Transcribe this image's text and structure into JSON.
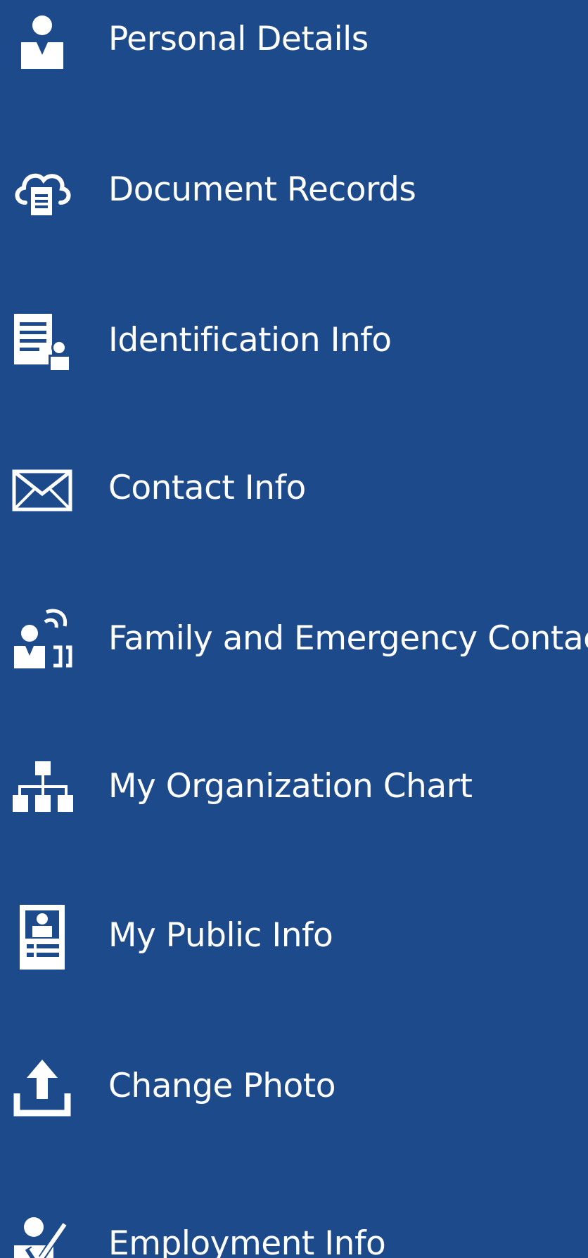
{
  "menu": {
    "items": [
      {
        "label": "Personal Details",
        "icon": "person-icon"
      },
      {
        "label": "Document Records",
        "icon": "cloud-document-icon"
      },
      {
        "label": "Identification Info",
        "icon": "id-document-icon"
      },
      {
        "label": "Contact Info",
        "icon": "envelope-icon"
      },
      {
        "label": "Family and Emergency Contacts",
        "icon": "contacts-call-icon"
      },
      {
        "label": "My Organization Chart",
        "icon": "org-chart-icon"
      },
      {
        "label": "My Public Info",
        "icon": "id-badge-icon"
      },
      {
        "label": "Change Photo",
        "icon": "upload-icon"
      },
      {
        "label": "Employment Info",
        "icon": "person-check-icon"
      }
    ]
  },
  "colors": {
    "background": "#1d4a8b",
    "text": "#ffffff"
  }
}
